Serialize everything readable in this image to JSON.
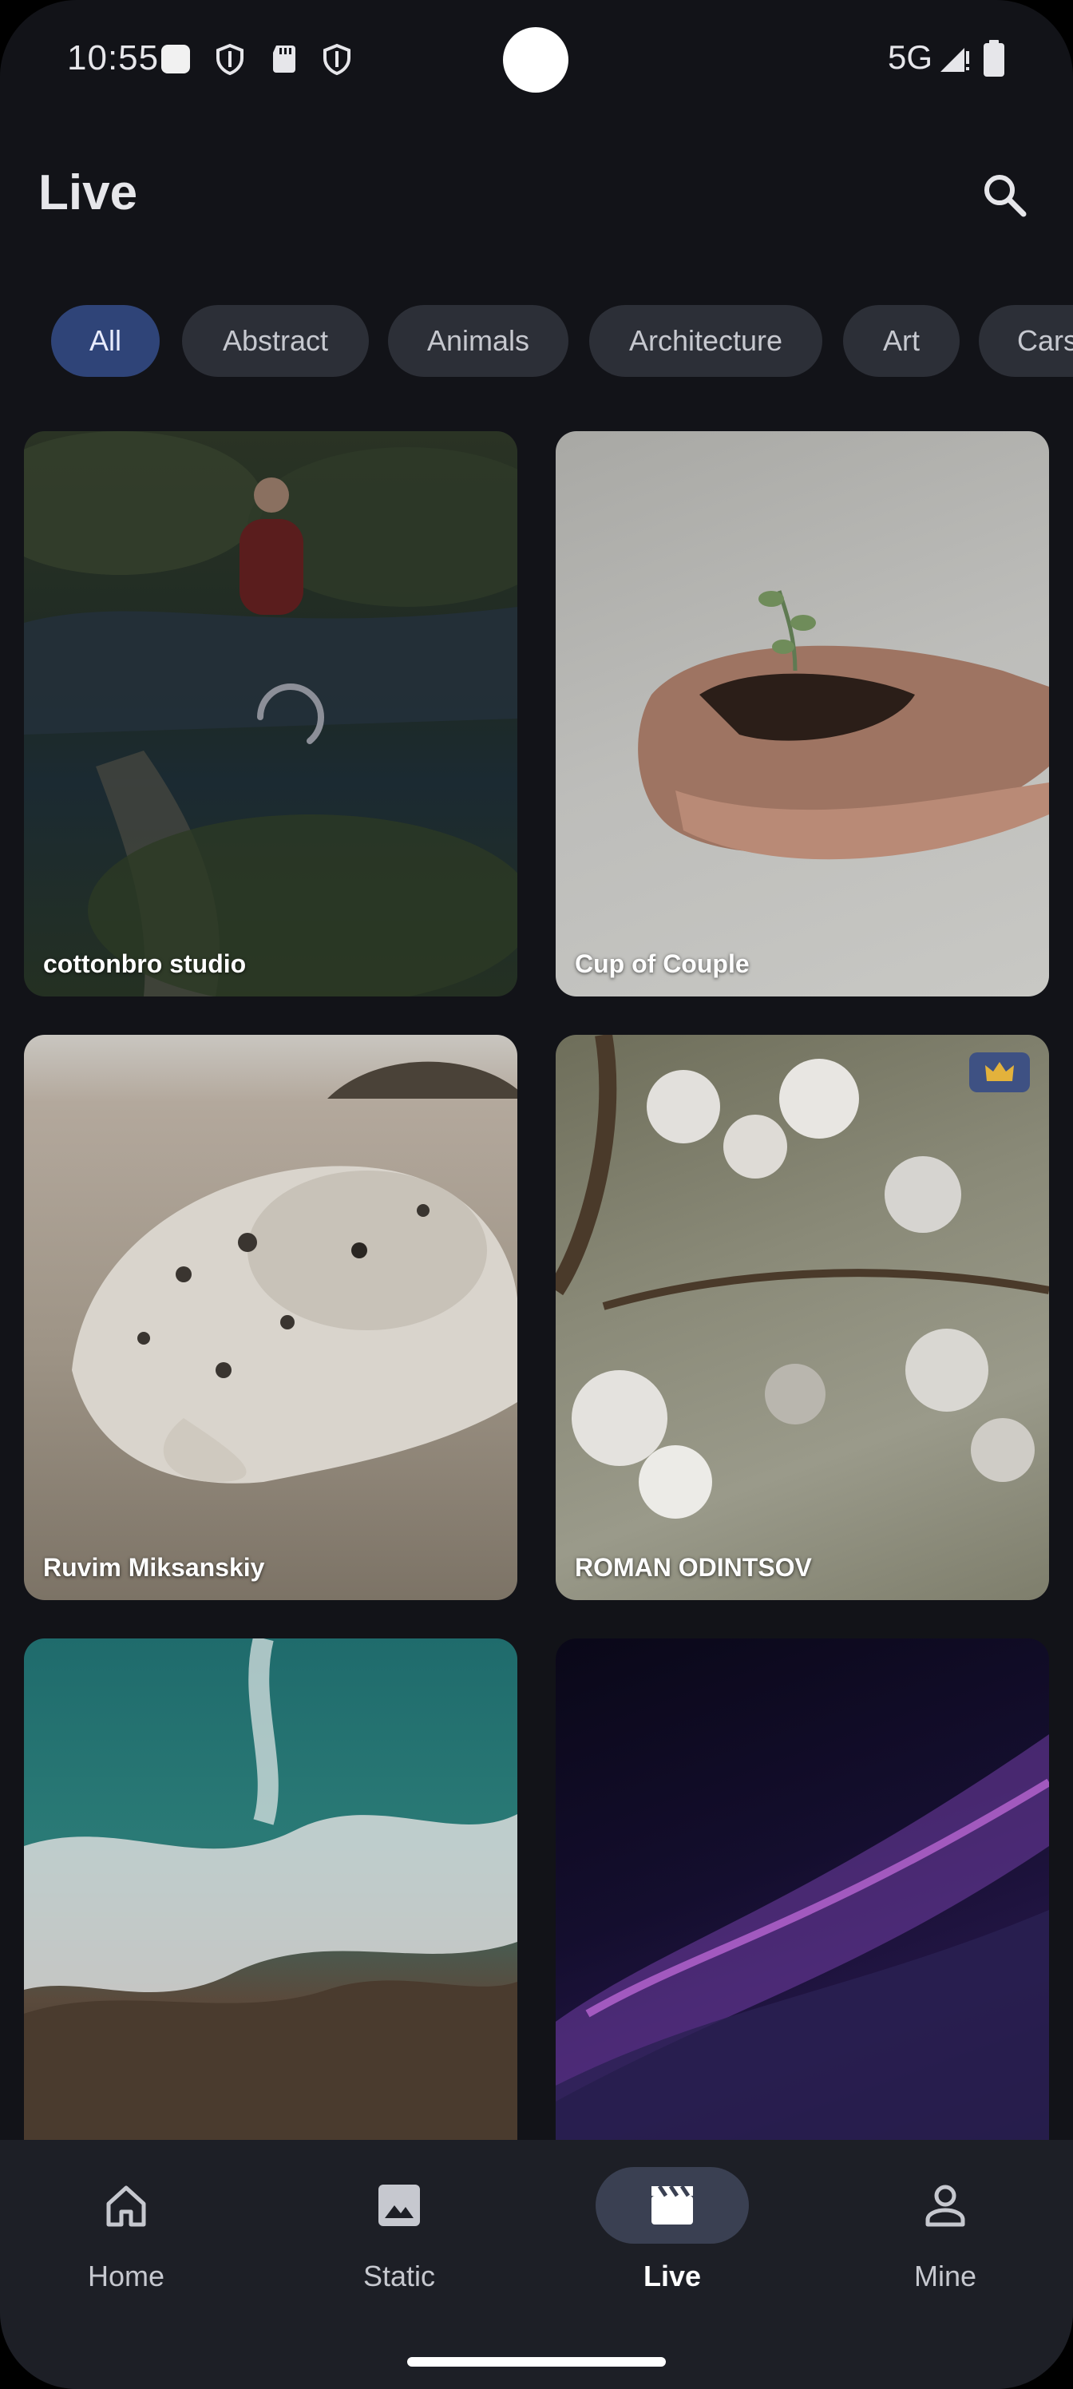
{
  "status_bar": {
    "time": "10:55",
    "network": "5G",
    "icons": [
      "notification-square-icon",
      "shield-icon",
      "sd-card-icon",
      "shield-icon",
      "signal-icon",
      "battery-icon"
    ]
  },
  "header": {
    "title": "Live",
    "search_icon": "search-icon"
  },
  "categories": {
    "selected": "All",
    "items": [
      "All",
      "Abstract",
      "Animals",
      "Architecture",
      "Art",
      "Cars"
    ]
  },
  "wallpapers": [
    {
      "author": "cottonbro studio",
      "loading": true,
      "premium": false
    },
    {
      "author": "Cup of  Couple",
      "loading": false,
      "premium": false
    },
    {
      "author": "Ruvim Miksanskiy",
      "loading": false,
      "premium": false
    },
    {
      "author": "ROMAN ODINTSOV",
      "loading": false,
      "premium": true
    },
    {
      "author": "",
      "loading": false,
      "premium": false
    },
    {
      "author": "",
      "loading": false,
      "premium": false
    }
  ],
  "bottom_nav": {
    "selected": "Live",
    "items": [
      {
        "label": "Home",
        "icon": "home-icon"
      },
      {
        "label": "Static",
        "icon": "image-icon"
      },
      {
        "label": "Live",
        "icon": "movie-clapper-icon"
      },
      {
        "label": "Mine",
        "icon": "person-icon"
      }
    ]
  },
  "colors": {
    "background": "#121318",
    "chip": "#2c2f37",
    "chip_active": "#2f4478",
    "nav_background": "#1d1f26",
    "nav_active_pill": "#3a4052",
    "premium_badge": "#3e5183"
  }
}
